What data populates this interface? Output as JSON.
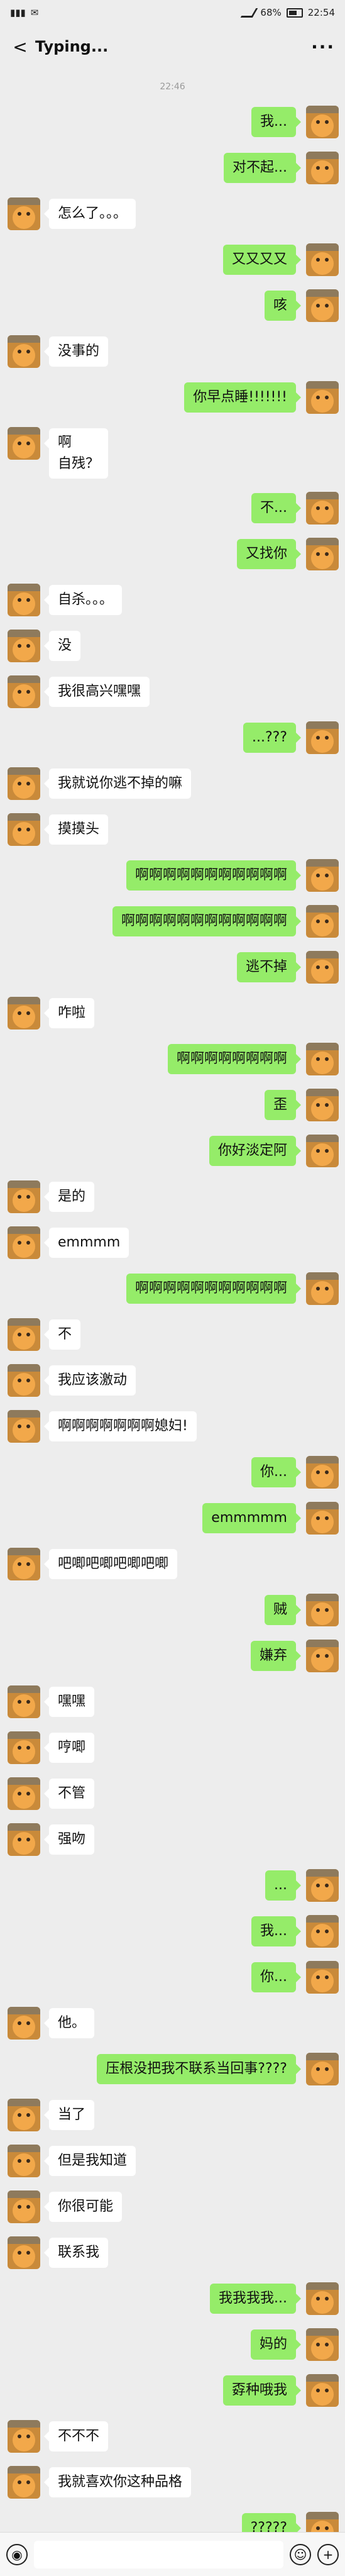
{
  "status": {
    "battery": "68%",
    "time": "22:54"
  },
  "header": {
    "title": "Typing...",
    "back": "<",
    "more": "···"
  },
  "timestamp": "22:46",
  "messages": [
    {
      "side": "out",
      "text": "我..."
    },
    {
      "side": "out",
      "text": "对不起..."
    },
    {
      "side": "in",
      "text": "怎么了。。。"
    },
    {
      "side": "out",
      "text": "又又又又"
    },
    {
      "side": "out",
      "text": "咳"
    },
    {
      "side": "in",
      "text": "没事的"
    },
    {
      "side": "out",
      "text": "你早点睡!!!!!!!"
    },
    {
      "side": "in",
      "text": "啊\n自残？"
    },
    {
      "side": "out",
      "text": "不..."
    },
    {
      "side": "out",
      "text": "又找你"
    },
    {
      "side": "in",
      "text": "自杀。。。"
    },
    {
      "side": "in",
      "text": "没"
    },
    {
      "side": "in",
      "text": "我很高兴嘿嘿"
    },
    {
      "side": "out",
      "text": "...???"
    },
    {
      "side": "in",
      "text": "我就说你逃不掉的嘛"
    },
    {
      "side": "in",
      "text": "摸摸头"
    },
    {
      "side": "out",
      "text": "啊啊啊啊啊啊啊啊啊啊啊"
    },
    {
      "side": "out",
      "text": "啊啊啊啊啊啊啊啊啊啊啊啊"
    },
    {
      "side": "out",
      "text": "逃不掉"
    },
    {
      "side": "in",
      "text": "咋啦"
    },
    {
      "side": "out",
      "text": "啊啊啊啊啊啊啊啊"
    },
    {
      "side": "out",
      "text": "歪"
    },
    {
      "side": "out",
      "text": "你好淡定阿"
    },
    {
      "side": "in",
      "text": "是的"
    },
    {
      "side": "in",
      "text": "emmmm"
    },
    {
      "side": "out",
      "text": "啊啊啊啊啊啊啊啊啊啊啊"
    },
    {
      "side": "in",
      "text": "不"
    },
    {
      "side": "in",
      "text": "我应该激动"
    },
    {
      "side": "in",
      "text": "啊啊啊啊啊啊啊媳妇!"
    },
    {
      "side": "out",
      "text": "你..."
    },
    {
      "side": "out",
      "text": "emmmmm"
    },
    {
      "side": "in",
      "text": "吧唧吧唧吧唧吧唧"
    },
    {
      "side": "out",
      "text": "贼"
    },
    {
      "side": "out",
      "text": "嫌弃"
    },
    {
      "side": "in",
      "text": "嘿嘿"
    },
    {
      "side": "in",
      "text": "哼唧"
    },
    {
      "side": "in",
      "text": "不管"
    },
    {
      "side": "in",
      "text": "强吻"
    },
    {
      "side": "out",
      "text": "..."
    },
    {
      "side": "out",
      "text": "我..."
    },
    {
      "side": "out",
      "text": "你..."
    },
    {
      "side": "in",
      "text": "他。"
    },
    {
      "side": "out",
      "text": "压根没把我不联系当回事????"
    },
    {
      "side": "in",
      "text": "当了"
    },
    {
      "side": "in",
      "text": "但是我知道"
    },
    {
      "side": "in",
      "text": "你很可能"
    },
    {
      "side": "in",
      "text": "联系我"
    },
    {
      "side": "out",
      "text": "我我我我..."
    },
    {
      "side": "out",
      "text": "妈的"
    },
    {
      "side": "out",
      "text": "孬种哦我"
    },
    {
      "side": "in",
      "text": "不不不"
    },
    {
      "side": "in",
      "text": "我就喜欢你这种品格"
    },
    {
      "side": "out",
      "text": "?????"
    }
  ],
  "inputbar": {
    "voice": "◉",
    "emoji": "☺",
    "plus": "+"
  }
}
